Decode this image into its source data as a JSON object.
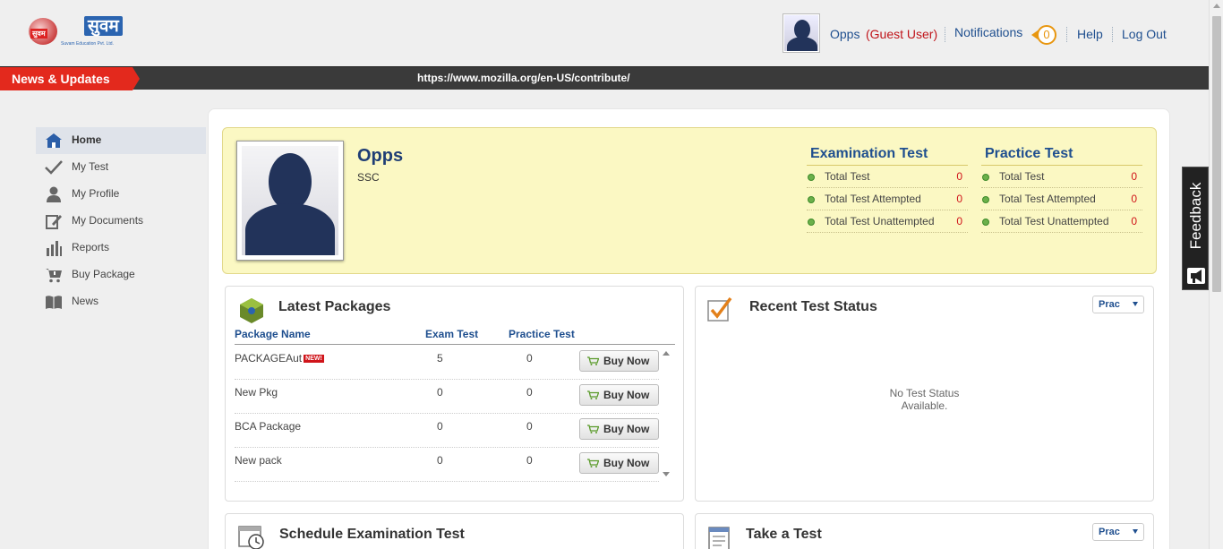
{
  "header": {
    "logo_text": "सुवम",
    "logo_sub": "Suvam Education Pvt. Ltd.",
    "user_name": "Opps",
    "user_role": "(Guest User)",
    "notifications_label": "Notifications",
    "notifications_count": "0",
    "help_label": "Help",
    "logout_label": "Log Out"
  },
  "newsbar": {
    "label": "News & Updates",
    "ticker": "https://www.mozilla.org/en-US/contribute/"
  },
  "sidebar": {
    "items": [
      {
        "label": "Home",
        "icon": "home-icon"
      },
      {
        "label": "My Test",
        "icon": "check-icon"
      },
      {
        "label": "My Profile",
        "icon": "user-icon"
      },
      {
        "label": "My Documents",
        "icon": "edit-document-icon"
      },
      {
        "label": "Reports",
        "icon": "bar-chart-icon"
      },
      {
        "label": "Buy Package",
        "icon": "cart-icon"
      },
      {
        "label": "News",
        "icon": "book-icon"
      }
    ]
  },
  "profile": {
    "name": "Opps",
    "course": "SSC",
    "exam": {
      "title": "Examination Test",
      "rows": [
        {
          "label": "Total Test",
          "value": "0"
        },
        {
          "label": "Total Test Attempted",
          "value": "0"
        },
        {
          "label": "Total Test Unattempted",
          "value": "0"
        }
      ]
    },
    "practice": {
      "title": "Practice Test",
      "rows": [
        {
          "label": "Total Test",
          "value": "0"
        },
        {
          "label": "Total Test Attempted",
          "value": "0"
        },
        {
          "label": "Total Test Unattempted",
          "value": "0"
        }
      ]
    }
  },
  "packages": {
    "title": "Latest Packages",
    "columns": [
      "Package Name",
      "Exam Test",
      "Practice Test"
    ],
    "new_badge": "NEW!",
    "buy_label": "Buy Now",
    "rows": [
      {
        "name": "PACKAGEAut",
        "exam": "5",
        "practice": "0"
      },
      {
        "name": "New Pkg",
        "exam": "0",
        "practice": "0"
      },
      {
        "name": "BCA Package",
        "exam": "0",
        "practice": "0"
      },
      {
        "name": "New pack",
        "exam": "0",
        "practice": "0"
      }
    ]
  },
  "recent": {
    "title": "Recent Test Status",
    "select_value": "Prac",
    "empty_line1": "No Test Status",
    "empty_line2": "Available."
  },
  "schedule": {
    "title": "Schedule Examination Test"
  },
  "take_test": {
    "title": "Take a Test",
    "select_value": "Prac"
  },
  "feedback": {
    "label": "Feedback"
  },
  "colors": {
    "accent_red": "#e3291d",
    "brand_blue": "#1f4f8f",
    "profile_bg": "#fbf8c3"
  }
}
